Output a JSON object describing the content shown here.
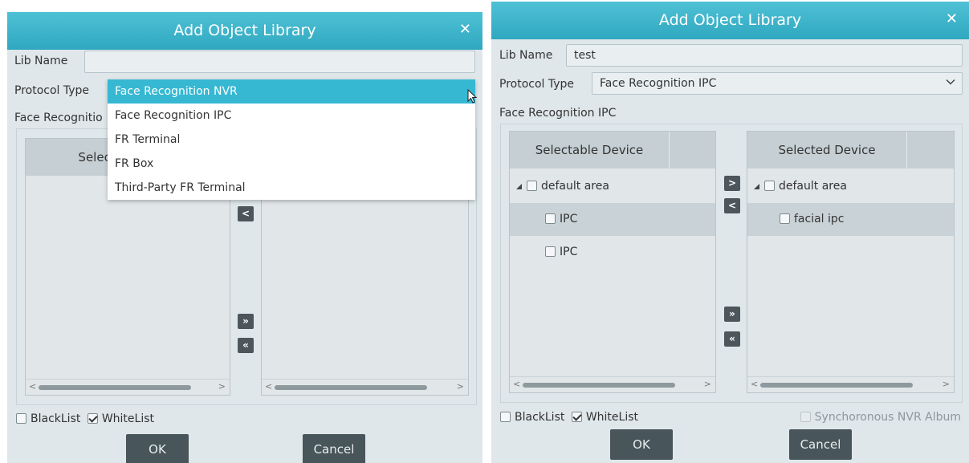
{
  "left_dialog": {
    "title": "Add Object Library",
    "close_icon": "close-icon",
    "lib_name_label": "Lib Name",
    "lib_name_value": "",
    "protocol_label": "Protocol Type",
    "dropdown_options": [
      "Face Recognition NVR",
      "Face Recognition IPC",
      "FR Terminal",
      "FR Box",
      "Third-Party FR Terminal"
    ],
    "dropdown_selected": "Face Recognition NVR",
    "section_label_partial": "Face Recognitio",
    "selectable_header_partial": "Selectabl",
    "remove_btn": "<",
    "add_all_btn": "»",
    "remove_all_btn": "«",
    "blacklist_label": "BlackList",
    "whitelist_label": "WhiteList",
    "ok_label": "OK",
    "cancel_label": "Cancel"
  },
  "right_dialog": {
    "title": "Add Object Library",
    "close_icon": "close-icon",
    "lib_name_label": "Lib Name",
    "lib_name_value": "test",
    "protocol_label": "Protocol Type",
    "protocol_value": "Face Recognition IPC",
    "section_label": "Face Recognition IPC",
    "selectable_header": "Selectable Device",
    "selected_header": "Selected Device",
    "selectable_items": [
      {
        "label": "default area",
        "level": 0,
        "checked": false
      },
      {
        "label": "IPC",
        "level": 1,
        "checked": false
      },
      {
        "label": "IPC",
        "level": 1,
        "checked": false
      }
    ],
    "selected_items": [
      {
        "label": "default area",
        "level": 0,
        "checked": false
      },
      {
        "label": "facial ipc",
        "level": 1,
        "checked": false
      }
    ],
    "add_btn": ">",
    "remove_btn": "<",
    "add_all_btn": "»",
    "remove_all_btn": "«",
    "blacklist_label": "BlackList",
    "blacklist_checked": false,
    "whitelist_label": "WhiteList",
    "whitelist_checked": true,
    "sync_label": "Synchoronous NVR Album",
    "ok_label": "OK",
    "cancel_label": "Cancel"
  },
  "colors": {
    "title_bar": "#3bb3c9",
    "dialog_bg": "#dfe7ea",
    "selected_option": "#36b8d2",
    "button_dark": "#48555a"
  }
}
